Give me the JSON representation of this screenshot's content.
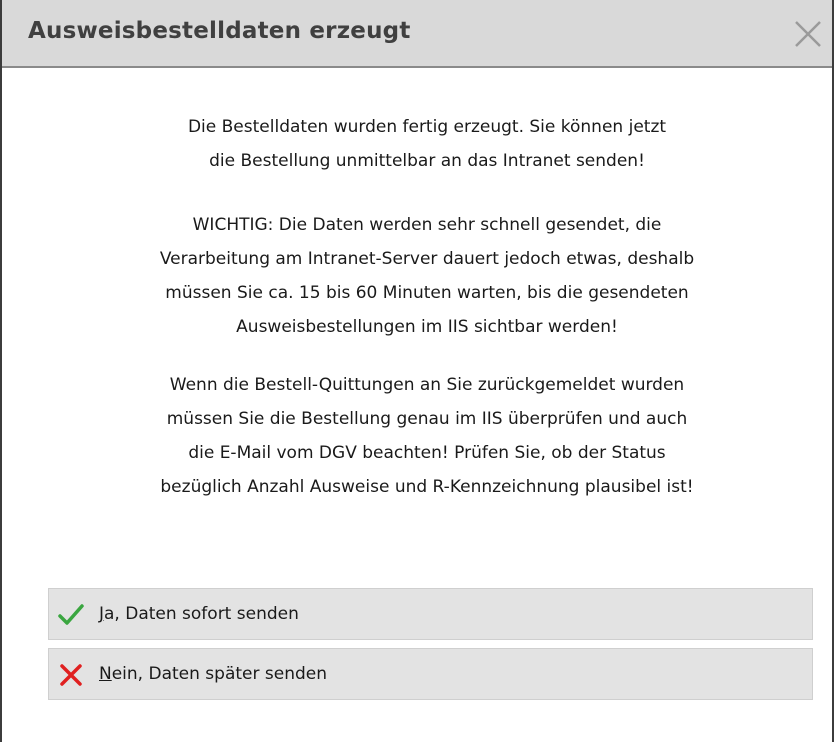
{
  "dialog": {
    "title": "Ausweisbestelldaten erzeugt",
    "close_icon": "close-icon"
  },
  "message": {
    "paragraph1": [
      "Die Bestelldaten wurden fertig erzeugt. Sie können jetzt",
      "die Bestellung unmittelbar an das Intranet senden!"
    ],
    "paragraph2": [
      "WICHTIG: Die Daten werden sehr schnell gesendet, die",
      "Verarbeitung am Intranet-Server dauert jedoch etwas, deshalb",
      "müssen Sie ca. 15 bis 60 Minuten warten, bis die gesendeten",
      "Ausweisbestellungen im IIS sichtbar werden!"
    ],
    "paragraph3": [
      "Wenn die Bestell-Quittungen an Sie zurückgemeldet wurden",
      "müssen Sie die Bestellung genau im IIS überprüfen und auch",
      "die E-Mail vom DGV beachten! Prüfen Sie, ob der Status",
      "bezüglich Anzahl Ausweise und R-Kennzeichnung plausibel ist!"
    ]
  },
  "buttons": {
    "yes": {
      "accel": "J",
      "label_rest": "a, Daten sofort senden",
      "icon": "checkmark-icon",
      "color": "#3aa640"
    },
    "no": {
      "accel": "N",
      "label_rest": "ein, Daten später senden",
      "icon": "cross-icon",
      "color": "#e02020"
    }
  }
}
